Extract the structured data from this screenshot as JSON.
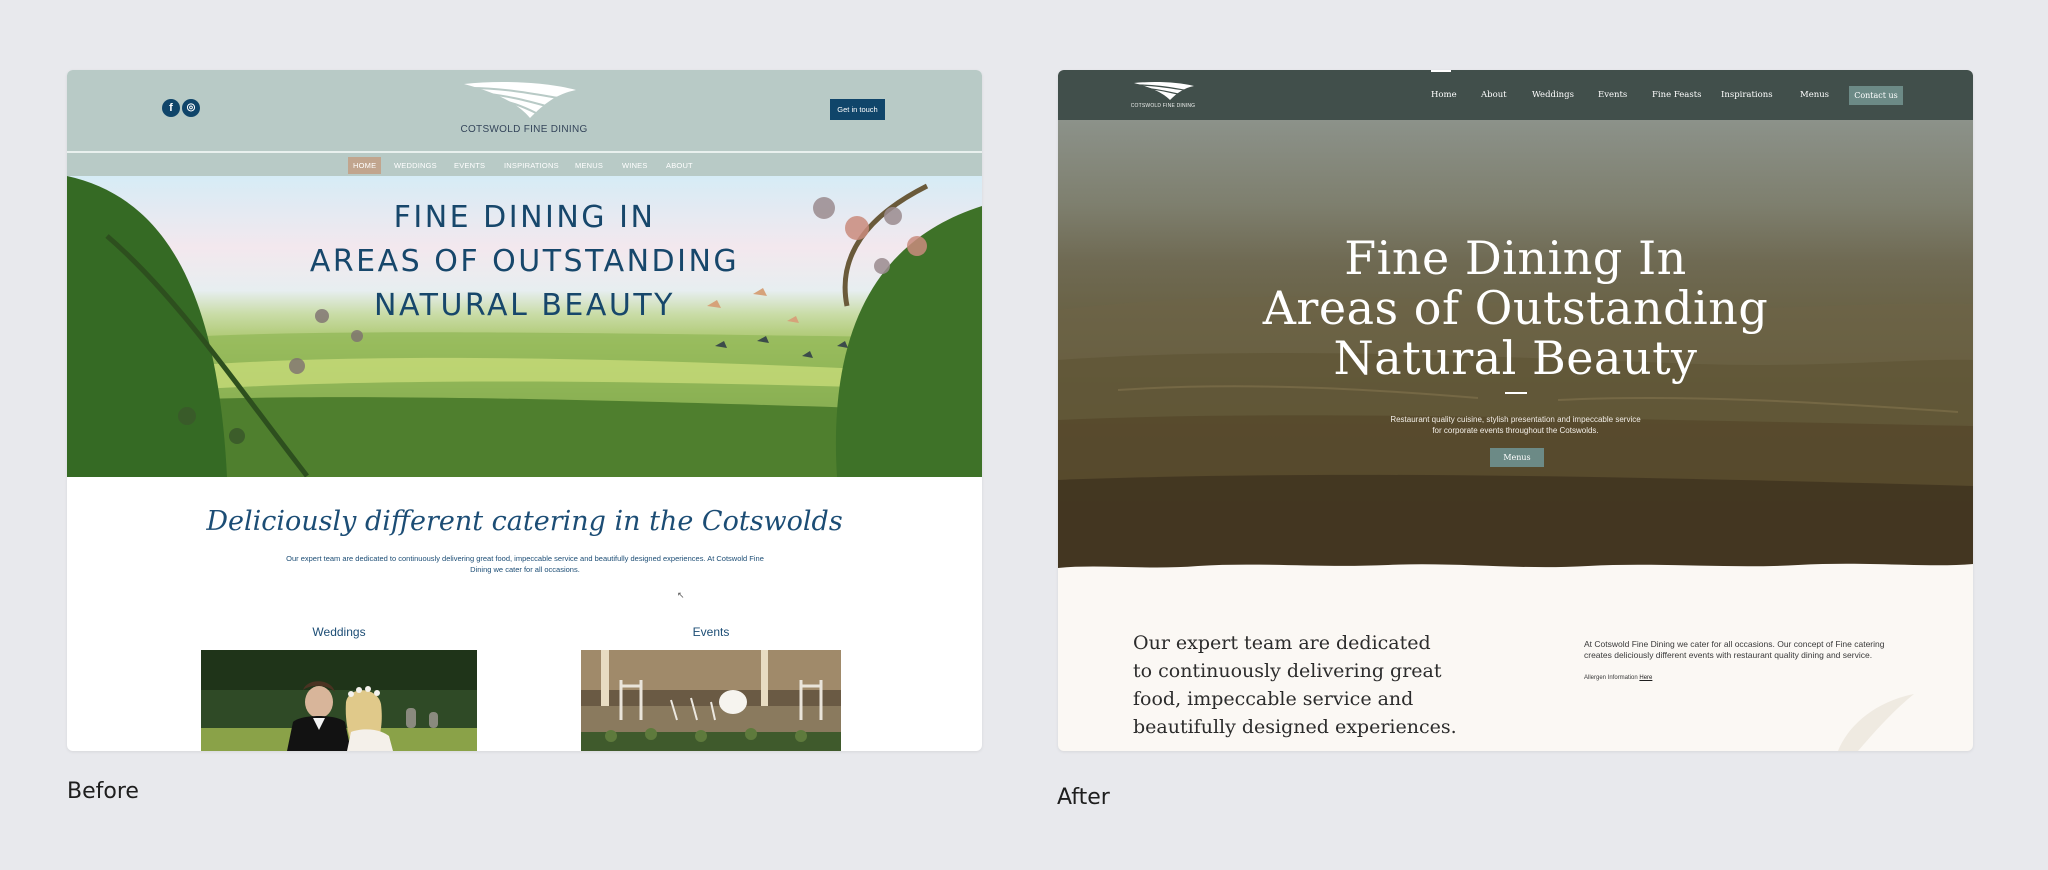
{
  "captions": {
    "before": "Before",
    "after": "After"
  },
  "before": {
    "header": {
      "social": [
        {
          "icon": "facebook-icon",
          "glyph": "f"
        },
        {
          "icon": "instagram-icon",
          "glyph": "◎"
        }
      ],
      "logo_text": "COTSWOLD FINE DINING",
      "cta": "Get in touch"
    },
    "nav": [
      "HOME",
      "WEDDINGS",
      "EVENTS",
      "INSPIRATIONS",
      "MENUS",
      "WINES",
      "ABOUT"
    ],
    "hero": {
      "lines": [
        "FINE DINING IN",
        "AREAS OF OUTSTANDING",
        "NATURAL BEAUTY"
      ]
    },
    "tagline": "Deliciously different catering in the Cotswolds",
    "intro": "Our expert team are dedicated to continuously delivering great food, impeccable service and beautifully designed experiences. At Cotswold Fine Dining we cater for all occasions.",
    "cards": [
      {
        "title": "Weddings"
      },
      {
        "title": "Events"
      }
    ]
  },
  "after": {
    "header": {
      "logo_text": "COTSWOLD FINE DINING",
      "nav": [
        "Home",
        "About",
        "Weddings",
        "Events",
        "Fine Feasts",
        "Inspirations",
        "Menus"
      ],
      "contact": "Contact us"
    },
    "hero": {
      "lines": [
        "Fine Dining In",
        "Areas of Outstanding",
        "Natural Beauty"
      ],
      "sub_lines": [
        "Restaurant quality cuisine, stylish presentation and impeccable service",
        "for corporate events throughout the Cotswolds."
      ],
      "button": "Menus"
    },
    "lead_lines": [
      "Our expert team are dedicated",
      "to continuously delivering great",
      "food, impeccable service and",
      "beautifully designed experiences."
    ],
    "side_lines": [
      "At Cotswold Fine Dining we cater for all occasions. Our concept of Fine catering",
      "creates deliciously different events with restaurant quality dining and service."
    ],
    "allergen": {
      "label": "Allergen Information",
      "link": "Here"
    }
  },
  "colors": {
    "before_header": "#b8cac6",
    "before_navy": "#10456a",
    "before_active_tab": "#c1a58e",
    "after_header": "#414f4b",
    "after_button": "#6c8a86",
    "after_body": "#fbf8f4"
  }
}
